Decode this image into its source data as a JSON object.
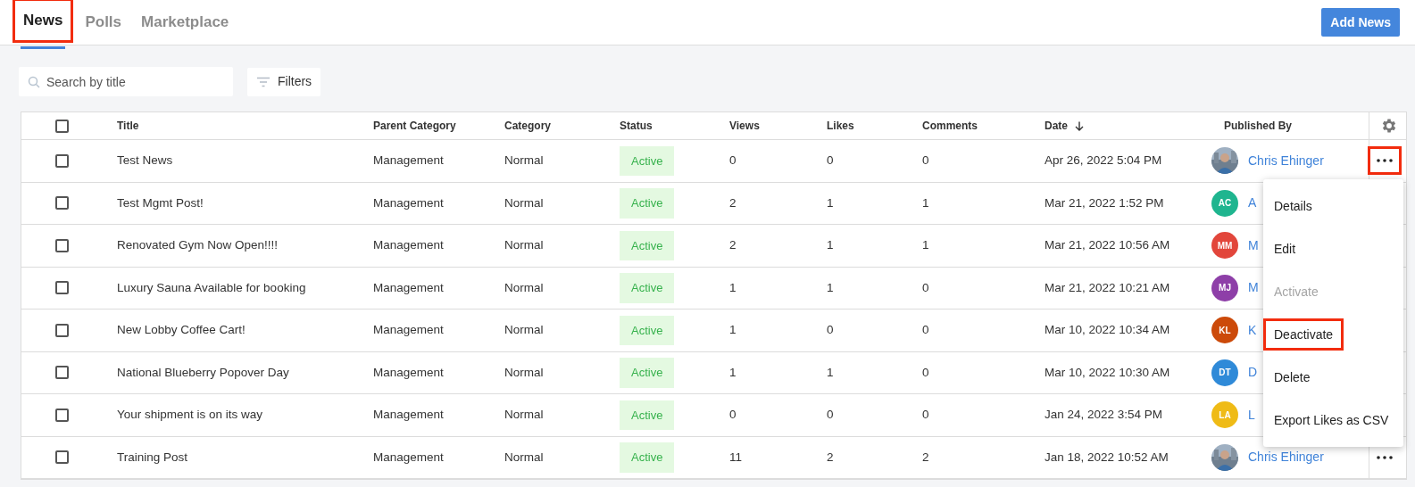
{
  "tabs": [
    {
      "label": "News",
      "selected": true,
      "highlighted": true
    },
    {
      "label": "Polls",
      "selected": false,
      "highlighted": false
    },
    {
      "label": "Marketplace",
      "selected": false,
      "highlighted": false
    }
  ],
  "add_button": "Add News",
  "search": {
    "placeholder": "Search by title"
  },
  "filters_button": "Filters",
  "table": {
    "select_all": {
      "checked": false
    },
    "columns": [
      {
        "label": "Title",
        "sorted": false
      },
      {
        "label": "Parent Category",
        "sorted": false
      },
      {
        "label": "Category",
        "sorted": false
      },
      {
        "label": "Status",
        "sorted": false
      },
      {
        "label": "Views",
        "sorted": false
      },
      {
        "label": "Likes",
        "sorted": false
      },
      {
        "label": "Comments",
        "sorted": false
      },
      {
        "label": "Date",
        "sorted": true
      },
      {
        "label": "Published By",
        "sorted": false
      }
    ],
    "rows": [
      {
        "checked": false,
        "title": "Test News",
        "parent_category": "Management",
        "category": "Normal",
        "status": "Active",
        "views": "0",
        "likes": "0",
        "comments": "0",
        "date": "Apr 26, 2022 5:04 PM",
        "publisher": "Chris Ehinger",
        "menu_highlighted": true
      },
      {
        "checked": false,
        "title": "Test Mgmt Post!",
        "parent_category": "Management",
        "category": "Normal",
        "status": "Active",
        "views": "2",
        "likes": "1",
        "comments": "1",
        "date": "Mar 21, 2022 1:52 PM",
        "avatar": {
          "kind": "initials",
          "initials": "AC",
          "color": "#1fb58f"
        },
        "publisher": "A"
      },
      {
        "checked": false,
        "title": "Renovated Gym Now Open!!!!",
        "parent_category": "Management",
        "category": "Normal",
        "status": "Active",
        "views": "2",
        "likes": "1",
        "comments": "1",
        "date": "Mar 21, 2022 10:56 AM",
        "avatar": {
          "kind": "initials",
          "initials": "MM",
          "color": "#e2463b"
        },
        "publisher": "M"
      },
      {
        "checked": false,
        "title": "Luxury Sauna Available for booking",
        "parent_category": "Management",
        "category": "Normal",
        "status": "Active",
        "views": "1",
        "likes": "1",
        "comments": "0",
        "date": "Mar 21, 2022 10:21 AM",
        "avatar": {
          "kind": "initials",
          "initials": "MJ",
          "color": "#8e3fa8"
        },
        "publisher": "M"
      },
      {
        "checked": false,
        "title": "New Lobby Coffee Cart!",
        "parent_category": "Management",
        "category": "Normal",
        "status": "Active",
        "views": "1",
        "likes": "0",
        "comments": "0",
        "date": "Mar 10, 2022 10:34 AM",
        "avatar": {
          "kind": "initials",
          "initials": "KL",
          "color": "#cc4a0a"
        },
        "publisher": "K"
      },
      {
        "checked": false,
        "title": "National Blueberry Popover Day",
        "parent_category": "Management",
        "category": "Normal",
        "status": "Active",
        "views": "1",
        "likes": "1",
        "comments": "0",
        "date": "Mar 10, 2022 10:30 AM",
        "avatar": {
          "kind": "initials",
          "initials": "DT",
          "color": "#2f8ad8"
        },
        "publisher": "D"
      },
      {
        "checked": false,
        "title": "Your shipment is on its way",
        "parent_category": "Management",
        "category": "Normal",
        "status": "Active",
        "views": "0",
        "likes": "0",
        "comments": "0",
        "date": "Jan 24, 2022 3:54 PM",
        "avatar": {
          "kind": "initials",
          "initials": "LA",
          "color": "#efbb16"
        },
        "publisher": "L"
      },
      {
        "checked": false,
        "title": "Training Post",
        "parent_category": "Management",
        "category": "Normal",
        "status": "Active",
        "views": "11",
        "likes": "2",
        "comments": "2",
        "date": "Jan 18, 2022 10:52 AM",
        "publisher": "Chris Ehinger",
        "menu_highlighted": false
      }
    ]
  },
  "row_menu": {
    "items": [
      {
        "label": "Details",
        "disabled": false,
        "highlighted": false
      },
      {
        "label": "Edit",
        "disabled": false,
        "highlighted": false
      },
      {
        "label": "Activate",
        "disabled": true,
        "highlighted": false
      },
      {
        "label": "Deactivate",
        "disabled": false,
        "highlighted": true
      },
      {
        "label": "Delete",
        "disabled": false,
        "highlighted": false
      },
      {
        "label": "Export Likes as CSV",
        "disabled": false,
        "highlighted": false
      }
    ]
  }
}
